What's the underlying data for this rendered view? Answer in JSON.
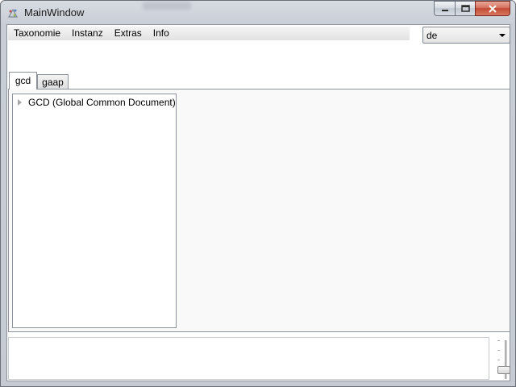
{
  "window": {
    "title": "MainWindow",
    "controls": {
      "minimize_icon": "minimize-icon",
      "maximize_icon": "maximize-icon",
      "close_icon": "close-icon"
    }
  },
  "menu": {
    "items": [
      {
        "label": "Taxonomie"
      },
      {
        "label": "Instanz"
      },
      {
        "label": "Extras"
      },
      {
        "label": "Info"
      }
    ]
  },
  "language_select": {
    "value": "de"
  },
  "tabs": [
    {
      "label": "gcd",
      "selected": true
    },
    {
      "label": "gaap",
      "selected": false
    }
  ],
  "tree": {
    "nodes": [
      {
        "label": "GCD (Global Common Document)",
        "expanded": false
      }
    ]
  },
  "output": {
    "text": ""
  },
  "colors": {
    "close_button": "#c24a33",
    "tab_panel_bg": "#f9f9f9"
  }
}
